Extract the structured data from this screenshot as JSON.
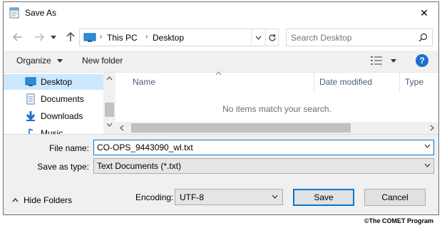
{
  "window": {
    "title": "Save As",
    "close_glyph": "✕"
  },
  "address": {
    "crumbs": [
      "This PC",
      "Desktop"
    ],
    "search_placeholder": "Search Desktop"
  },
  "toolbar": {
    "organize_label": "Organize",
    "new_folder_label": "New folder",
    "help_label": "?"
  },
  "nav_pane": {
    "items": [
      {
        "label": "Desktop",
        "icon": "desktop-icon",
        "selected": true
      },
      {
        "label": "Documents",
        "icon": "documents-icon",
        "selected": false
      },
      {
        "label": "Downloads",
        "icon": "downloads-icon",
        "selected": false
      },
      {
        "label": "Music",
        "icon": "music-icon",
        "selected": false
      }
    ]
  },
  "file_list": {
    "columns": [
      "Name",
      "Date modified",
      "Type"
    ],
    "empty_message": "No items match your search."
  },
  "form": {
    "filename_label": "File name:",
    "filename_value": "CO-OPS_9443090_wl.txt",
    "filetype_label": "Save as type:",
    "filetype_value": "Text Documents (*.txt)"
  },
  "footer": {
    "hide_folders_label": "Hide Folders",
    "encoding_label": "Encoding:",
    "encoding_value": "UTF-8",
    "save_label": "Save",
    "cancel_label": "Cancel"
  },
  "copyright": "©The COMET Program",
  "colors": {
    "accent": "#0078d7",
    "selection": "#cce8ff",
    "help_icon": "#1e6fd0"
  }
}
